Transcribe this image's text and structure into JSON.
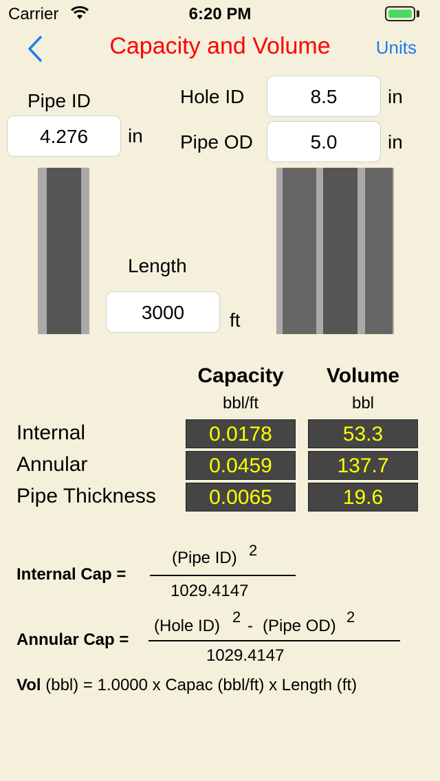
{
  "status_bar": {
    "carrier": "Carrier",
    "time": "6:20 PM"
  },
  "nav": {
    "title": "Capacity and Volume",
    "units_label": "Units",
    "back_icon": "chevron-left-icon"
  },
  "inputs": {
    "pipe_id": {
      "label": "Pipe ID",
      "value": "4.276",
      "unit": "in"
    },
    "hole_id": {
      "label": "Hole ID",
      "value": "8.5",
      "unit": "in"
    },
    "pipe_od": {
      "label": "Pipe OD",
      "value": "5.0",
      "unit": "in"
    },
    "length": {
      "label": "Length",
      "value": "3000",
      "unit": "ft"
    }
  },
  "results": {
    "headers": [
      {
        "title": "Capacity",
        "unit": "bbl/ft"
      },
      {
        "title": "Volume",
        "unit": "bbl"
      }
    ],
    "rows": [
      {
        "label": "Internal",
        "capacity": "0.0178",
        "volume": "53.3"
      },
      {
        "label": "Annular",
        "capacity": "0.0459",
        "volume": "137.7"
      },
      {
        "label": "Pipe Thickness",
        "capacity": "0.0065",
        "volume": "19.6"
      }
    ]
  },
  "formulas": {
    "internal": {
      "label": "Internal Cap =",
      "numerator": "(Pipe ID)",
      "exp": "2",
      "denominator": "1029.4147"
    },
    "annular": {
      "label": "Annular Cap =",
      "num_a": "(Hole ID)",
      "exp_a": "2",
      "minus": "-",
      "num_b": "(Pipe OD)",
      "exp_b": "2",
      "denominator": "1029.4147"
    },
    "volume": {
      "bold": "Vol",
      "rest": " (bbl) = 1.0000 x Capac (bbl/ft) x Length (ft)"
    }
  },
  "colors": {
    "background": "#f5f0db",
    "title": "#ff0000",
    "link": "#1a7cf2",
    "cell_bg": "#454545",
    "cell_text": "#ffff00"
  }
}
